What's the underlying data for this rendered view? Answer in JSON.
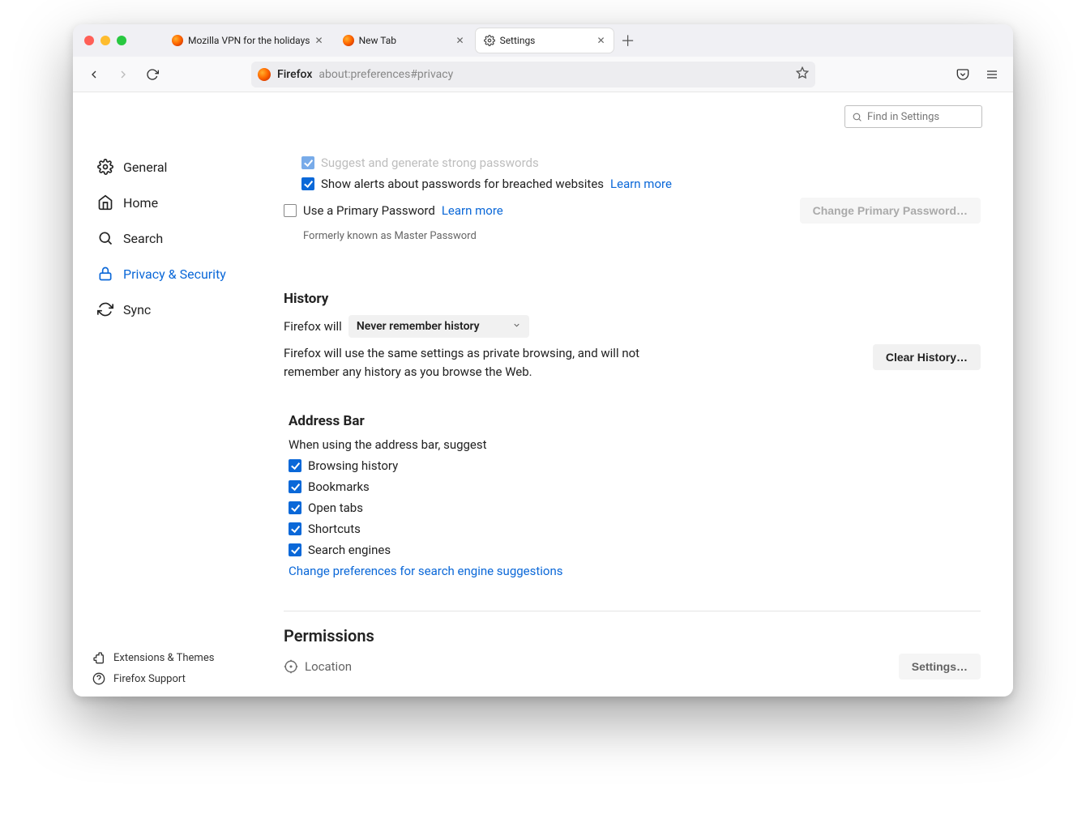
{
  "tabs": [
    {
      "title": "Mozilla VPN for the holidays",
      "active": false
    },
    {
      "title": "New Tab",
      "active": false
    },
    {
      "title": "Settings",
      "active": true
    }
  ],
  "urlbar": {
    "product": "Firefox",
    "url": "about:preferences#privacy"
  },
  "search_placeholder": "Find in Settings",
  "sidebar": {
    "items": [
      {
        "label": "General"
      },
      {
        "label": "Home"
      },
      {
        "label": "Search"
      },
      {
        "label": "Privacy & Security"
      },
      {
        "label": "Sync"
      }
    ],
    "footer": [
      {
        "label": "Extensions & Themes"
      },
      {
        "label": "Firefox Support"
      }
    ]
  },
  "passwords": {
    "suggest_strong": "Suggest and generate strong passwords",
    "breach_alerts": "Show alerts about passwords for breached websites",
    "learn_more": "Learn more",
    "use_primary": "Use a Primary Password",
    "formerly": "Formerly known as Master Password",
    "change_btn": "Change Primary Password…"
  },
  "history": {
    "heading": "History",
    "firefox_will": "Firefox will",
    "select_value": "Never remember history",
    "desc": "Firefox will use the same settings as private browsing, and will not remember any history as you browse the Web.",
    "clear_btn": "Clear History…"
  },
  "addressbar": {
    "heading": "Address Bar",
    "sub": "When using the address bar, suggest",
    "items": [
      "Browsing history",
      "Bookmarks",
      "Open tabs",
      "Shortcuts",
      "Search engines"
    ],
    "change_link": "Change preferences for search engine suggestions"
  },
  "permissions": {
    "heading": "Permissions",
    "location": "Location",
    "settings_btn": "Settings…"
  }
}
